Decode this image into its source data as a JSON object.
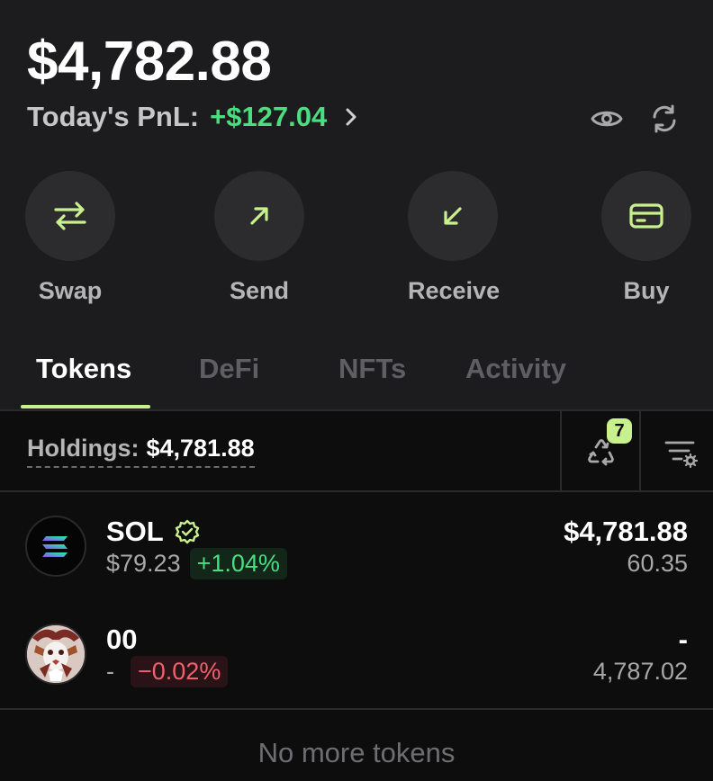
{
  "wallet": {
    "balance": "$4,782.88",
    "pnl_label": "Today's PnL:",
    "pnl_value": "+$127.04"
  },
  "actions": [
    {
      "label": "Swap",
      "icon": "swap-arrows-icon"
    },
    {
      "label": "Send",
      "icon": "arrow-up-right-icon"
    },
    {
      "label": "Receive",
      "icon": "arrow-down-left-icon"
    },
    {
      "label": "Buy",
      "icon": "credit-card-icon"
    }
  ],
  "tabs": [
    "Tokens",
    "DeFi",
    "NFTs",
    "Activity"
  ],
  "active_tab": "Tokens",
  "holdings": {
    "label": "Holdings:",
    "value": "$4,781.88",
    "recycle_badge": "7"
  },
  "tokens": [
    {
      "symbol": "SOL",
      "verified": true,
      "price": "$79.23",
      "change": "+1.04%",
      "direction": "up",
      "value": "$4,781.88",
      "amount": "60.35"
    },
    {
      "symbol": "00",
      "verified": false,
      "price": "-",
      "change": "−0.02%",
      "direction": "down",
      "value": "-",
      "amount": "4,787.02"
    }
  ],
  "footer": "No more tokens",
  "colors": {
    "accent": "#c8f08f",
    "positive": "#4ade80",
    "negative": "#f0606e",
    "background": "#1c1c1e",
    "list_background": "#0d0d0e"
  }
}
